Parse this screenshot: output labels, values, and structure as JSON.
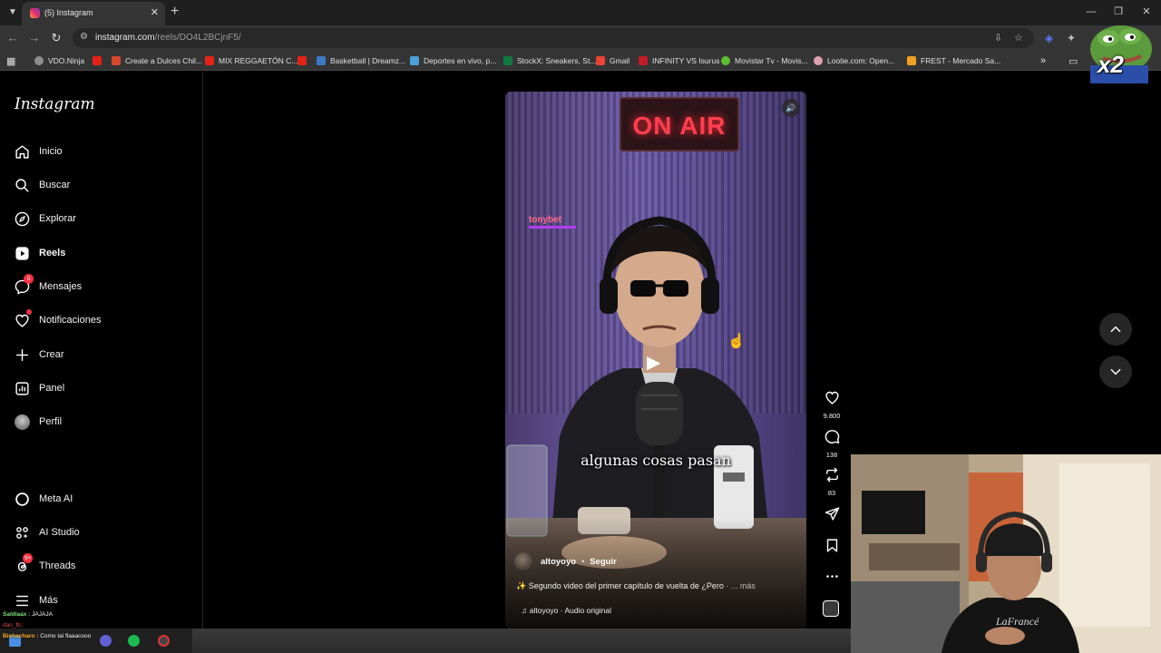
{
  "browser": {
    "tab_title": "(5) Instagram",
    "url_host": "instagram.com",
    "url_path": "/reels/DO4L2BCjnF5/",
    "bookmarks": [
      {
        "label": "VDO.Ninja",
        "color": "#8e8e8e"
      },
      {
        "label": "",
        "color": "#e62117"
      },
      {
        "label": "Create a Dulces Chil...",
        "color": "#d8472a"
      },
      {
        "label": "MIX REGGAETÓN C...",
        "color": "#e62117"
      },
      {
        "label": "",
        "color": "#e62117"
      },
      {
        "label": "Basketball | Dreamz...",
        "color": "#3d7ac6"
      },
      {
        "label": "Deportes en vivo, p...",
        "color": "#4aa0d9"
      },
      {
        "label": "StockX: Sneakers, St...",
        "color": "#0f7b41"
      },
      {
        "label": "Gmail",
        "color": "#ea4335"
      },
      {
        "label": "INFINITY VS Isurus",
        "color": "#c21d26"
      },
      {
        "label": "Movistar Tv - Movis...",
        "color": "#5fbf33"
      },
      {
        "label": "Lootie.com: Open...",
        "color": "#e0a0b0"
      },
      {
        "label": "FREST - Mercado Sa...",
        "color": "#f0a020"
      }
    ]
  },
  "sidebar": {
    "logo": "Instagram",
    "items": [
      {
        "label": "Inicio",
        "icon": "home-icon"
      },
      {
        "label": "Buscar",
        "icon": "search-icon"
      },
      {
        "label": "Explorar",
        "icon": "compass-icon"
      },
      {
        "label": "Reels",
        "icon": "reels-icon"
      },
      {
        "label": "Mensajes",
        "icon": "messenger-icon",
        "badge": "5"
      },
      {
        "label": "Notificaciones",
        "icon": "heart-icon"
      },
      {
        "label": "Crear",
        "icon": "plus-icon"
      },
      {
        "label": "Panel",
        "icon": "dashboard-icon"
      },
      {
        "label": "Perfil",
        "icon": "avatar"
      },
      {
        "label": "Meta AI",
        "icon": "meta-ai-icon"
      },
      {
        "label": "AI Studio",
        "icon": "ai-studio-icon"
      },
      {
        "label": "Threads",
        "icon": "threads-icon",
        "badge": "9+"
      },
      {
        "label": "Más",
        "icon": "menu-icon"
      }
    ]
  },
  "chat": {
    "line1_user": "Saldiaax :",
    "line1_text": "JAJAJA",
    "line2_user": "dan_fb :",
    "line3_user": "Bishacharo :",
    "line3_text": "Como tai flaaacooo"
  },
  "reel": {
    "sign": "ON AIR",
    "sponsor": "tonybet",
    "subtitle": "algunas cosas pasan",
    "author": "altoyoyo",
    "separator": "•",
    "follow": "Seguir",
    "caption": "Segundo video del primer capítulo de vuelta de ¿Pero",
    "caption_more": "· ... más",
    "audio": "altoyoyo · Audio original"
  },
  "actions": {
    "likes": "9.800",
    "comments": "138",
    "reposts": "83"
  },
  "overlay": {
    "pepe_label": "x2"
  }
}
